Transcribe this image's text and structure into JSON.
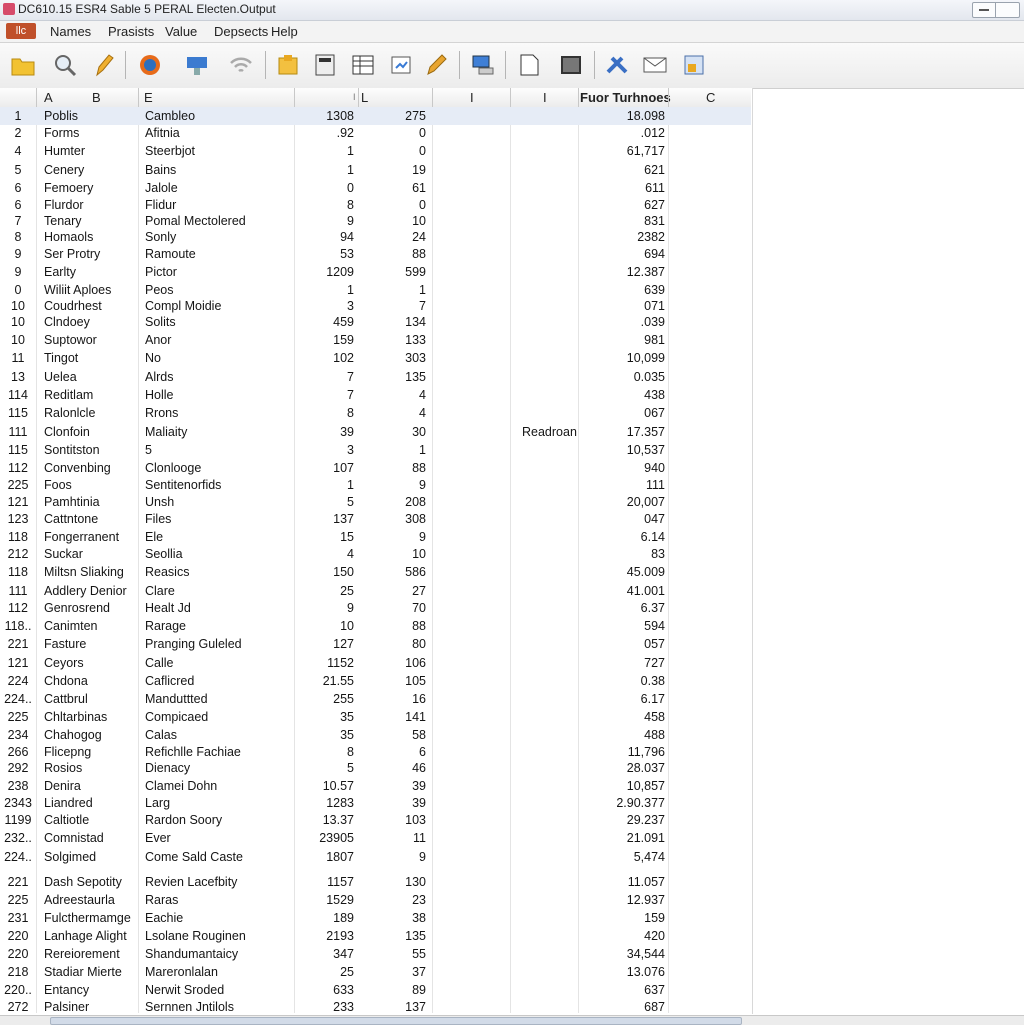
{
  "window": {
    "title": "DC610.15 ESR4 Sable 5 PERAL Electen.Output"
  },
  "menu": {
    "file_label": "llc",
    "items": [
      "Names",
      "Prasists",
      "Value",
      "Depsects",
      "Help"
    ]
  },
  "toolbar": {
    "icons": [
      "folder-icon",
      "zoom-icon",
      "pencil-icon",
      "browser-icon",
      "network-icon",
      "wifi-icon",
      "document-icon",
      "calculator-icon",
      "table-icon",
      "chart-icon",
      "edit-icon",
      "monitor-icon",
      "page-icon",
      "image-icon",
      "tools-icon",
      "mail-icon",
      "export-icon"
    ]
  },
  "sheet": {
    "headers": [
      "A",
      "B",
      "E",
      "I",
      "L",
      "I",
      "I",
      "Fuor Turhnoes",
      "C"
    ],
    "rows": [
      {
        "n": "1",
        "a": "Poblis",
        "b": "Cambleo",
        "v1": "1308",
        "v2": "275",
        "m": "",
        "v3": "18.098"
      },
      {
        "n": "2",
        "a": "Forms",
        "b": "Afitnia",
        "v1": ".92",
        "v2": "0",
        "m": "",
        "v3": ".012"
      },
      {
        "n": "4",
        "a": "Humter",
        "b": "Steerbjot",
        "v1": "1",
        "v2": "0",
        "m": "",
        "v3": "61,717"
      },
      {
        "n": "5",
        "a": "Cenery",
        "b": "Bains",
        "v1": "1",
        "v2": "19",
        "m": "",
        "v3": "621"
      },
      {
        "n": "6",
        "a": "Femoery",
        "b": "Jalole",
        "v1": "0",
        "v2": "61",
        "m": "",
        "v3": "611"
      },
      {
        "n": "6",
        "a": "Flurdor",
        "b": "Flidur",
        "v1": "8",
        "v2": "0",
        "m": "",
        "v3": "627"
      },
      {
        "n": "7",
        "a": "Tenary",
        "b": "Pomal Mectolered",
        "v1": "9",
        "v2": "10",
        "m": "",
        "v3": "831"
      },
      {
        "n": "8",
        "a": "Homaols",
        "b": "Sonly",
        "v1": "94",
        "v2": "24",
        "m": "",
        "v3": "2382"
      },
      {
        "n": "9",
        "a": "Ser Protry",
        "b": "Ramoute",
        "v1": "53",
        "v2": "88",
        "m": "",
        "v3": "694"
      },
      {
        "n": "9",
        "a": "Earlty",
        "b": "Pictor",
        "v1": "1209",
        "v2": "599",
        "m": "",
        "v3": "12.387"
      },
      {
        "n": "0",
        "a": "Wiliit Aploes",
        "b": "Peos",
        "v1": "1",
        "v2": "1",
        "m": "",
        "v3": "639"
      },
      {
        "n": "10",
        "a": "Coudrhest",
        "b": "Compl Moidie",
        "v1": "3",
        "v2": "7",
        "m": "",
        "v3": "071"
      },
      {
        "n": "10",
        "a": "Clndoey",
        "b": "Solits",
        "v1": "459",
        "v2": "134",
        "m": "",
        "v3": ".039"
      },
      {
        "n": "10",
        "a": "Suptowor",
        "b": "Anor",
        "v1": "159",
        "v2": "133",
        "m": "",
        "v3": "981"
      },
      {
        "n": "11",
        "a": "Tingot",
        "b": "No",
        "v1": "102",
        "v2": "303",
        "m": "",
        "v3": "10,099"
      },
      {
        "n": "13",
        "a": "Uelea",
        "b": "Alrds",
        "v1": "7",
        "v2": "135",
        "m": "",
        "v3": "0.035"
      },
      {
        "n": "114",
        "a": "Reditlam",
        "b": "Holle",
        "v1": "7",
        "v2": "4",
        "m": "",
        "v3": "438"
      },
      {
        "n": "115",
        "a": "Ralonlcle",
        "b": "Rrons",
        "v1": "8",
        "v2": "4",
        "m": "",
        "v3": "067"
      },
      {
        "n": "111",
        "a": "Clonfoin",
        "b": "Maliaity",
        "v1": "39",
        "v2": "30",
        "m": "Readroan",
        "v3": "17.357"
      },
      {
        "n": "115",
        "a": "Sontitston",
        "b": "5",
        "v1": "3",
        "v2": "1",
        "m": "",
        "v3": "10,537"
      },
      {
        "n": "112",
        "a": "Convenbing",
        "b": "Clonlooge",
        "v1": "107",
        "v2": "88",
        "m": "",
        "v3": "940"
      },
      {
        "n": "225",
        "a": "Foos",
        "b": "Sentitenorfids",
        "v1": "1",
        "v2": "9",
        "m": "",
        "v3": "111"
      },
      {
        "n": "121",
        "a": "Pamhtinia",
        "b": "Unsh",
        "v1": "5",
        "v2": "208",
        "m": "",
        "v3": "20,007"
      },
      {
        "n": "123",
        "a": "Cattntone",
        "b": "Files",
        "v1": "137",
        "v2": "308",
        "m": "",
        "v3": "047"
      },
      {
        "n": "118",
        "a": "Fongerranent",
        "b": "Ele",
        "v1": "15",
        "v2": "9",
        "m": "",
        "v3": "6.14"
      },
      {
        "n": "212",
        "a": "Suckar",
        "b": "Seollia",
        "v1": "4",
        "v2": "10",
        "m": "",
        "v3": "83"
      },
      {
        "n": "118",
        "a": "Miltsn Sliaking",
        "b": "Reasics",
        "v1": "150",
        "v2": "586",
        "m": "",
        "v3": "45.009"
      },
      {
        "n": "111",
        "a": "Addlery Denior",
        "b": "Clare",
        "v1": "25",
        "v2": "27",
        "m": "",
        "v3": "41.001"
      },
      {
        "n": "112",
        "a": "Genrosrend",
        "b": "Healt Jd",
        "v1": "9",
        "v2": "70",
        "m": "",
        "v3": "6.37"
      },
      {
        "n": "118..",
        "a": "Canimten",
        "b": "Rarage",
        "v1": "10",
        "v2": "88",
        "m": "",
        "v3": "594"
      },
      {
        "n": "221",
        "a": "Fasture",
        "b": "Pranging Guleled",
        "v1": "127",
        "v2": "80",
        "m": "",
        "v3": "057"
      },
      {
        "n": "121",
        "a": "Ceyors",
        "b": "Calle",
        "v1": "1152",
        "v2": "106",
        "m": "",
        "v3": "727"
      },
      {
        "n": "224",
        "a": "Chdona",
        "b": "Caflicred",
        "v1": "21.55",
        "v2": "105",
        "m": "",
        "v3": "0.38"
      },
      {
        "n": "224..",
        "a": "Cattbrul",
        "b": "Manduttted",
        "v1": "255",
        "v2": "16",
        "m": "",
        "v3": "6.17"
      },
      {
        "n": "225",
        "a": "Chltarbinas",
        "b": "Compicaed",
        "v1": "35",
        "v2": "141",
        "m": "",
        "v3": "458"
      },
      {
        "n": "234",
        "a": "Chahogog",
        "b": "Calas",
        "v1": "35",
        "v2": "58",
        "m": "",
        "v3": "488"
      },
      {
        "n": "266",
        "a": "Flicepng",
        "b": "Refichlle Fachiae",
        "v1": "8",
        "v2": "6",
        "m": "",
        "v3": "11,796"
      },
      {
        "n": "292",
        "a": "Rosios",
        "b": "Dienacy",
        "v1": "5",
        "v2": "46",
        "m": "",
        "v3": "28.037"
      },
      {
        "n": "238",
        "a": "Denira",
        "b": "Clamei Dohn",
        "v1": "10.57",
        "v2": "39",
        "m": "",
        "v3": "10,857"
      },
      {
        "n": "2343",
        "a": "Liandred",
        "b": "Larg",
        "v1": "1283",
        "v2": "39",
        "m": "",
        "v3": "2.90.377"
      },
      {
        "n": "1199",
        "a": "Caltiotle",
        "b": "Rardon Soory",
        "v1": "13.37",
        "v2": "103",
        "m": "",
        "v3": "29.237"
      },
      {
        "n": "232..",
        "a": "Comnistad",
        "b": "Ever",
        "v1": "23905",
        "v2": "11",
        "m": "",
        "v3": "21.091"
      },
      {
        "n": "224..",
        "a": "Solgimed",
        "b": "Come Sald Caste",
        "v1": "1807",
        "v2": "9",
        "m": "",
        "v3": "5,474"
      },
      {
        "n": "221",
        "a": "Dash Sepotity",
        "b": "Revien Lacefbity",
        "v1": "1157",
        "v2": "130",
        "m": "",
        "v3": "11.057"
      },
      {
        "n": "225",
        "a": "Adreestaurla",
        "b": "Raras",
        "v1": "1529",
        "v2": "23",
        "m": "",
        "v3": "12.937"
      },
      {
        "n": "231",
        "a": "Fulcthermamge",
        "b": "Eachie",
        "v1": "189",
        "v2": "38",
        "m": "",
        "v3": "159"
      },
      {
        "n": "220",
        "a": "Lanhage Alight",
        "b": "Lsolane Rouginen",
        "v1": "2193",
        "v2": "135",
        "m": "",
        "v3": "420"
      },
      {
        "n": "220",
        "a": "Rereiorement",
        "b": "Shandumantaicy",
        "v1": "347",
        "v2": "55",
        "m": "",
        "v3": "34,544"
      },
      {
        "n": "218",
        "a": "Stadiar Mierte",
        "b": "Mareronlalan",
        "v1": "25",
        "v2": "37",
        "m": "",
        "v3": "13.076"
      },
      {
        "n": "220..",
        "a": "Entancy",
        "b": "Nerwit Sroded",
        "v1": "633",
        "v2": "89",
        "m": "",
        "v3": "637"
      },
      {
        "n": "272",
        "a": "Palsiner",
        "b": "Sernnen Jntilols",
        "v1": "233",
        "v2": "137",
        "m": "",
        "v3": "687"
      }
    ]
  }
}
